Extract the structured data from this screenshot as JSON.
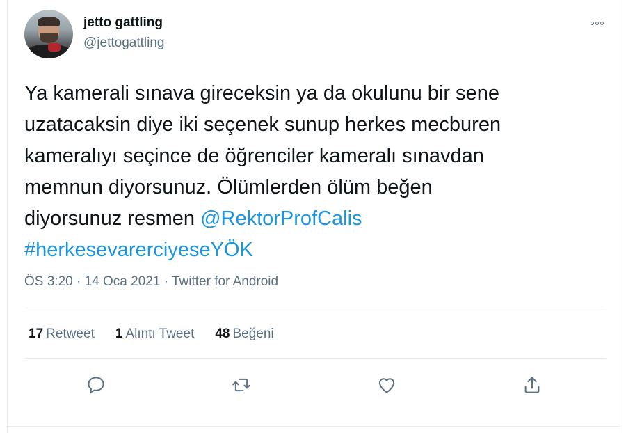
{
  "author": {
    "name": "jetto gattling",
    "handle": "@jettogattling"
  },
  "tweet": {
    "lines": [
      "Ya kamerali sınava gireceksin ya da okulunu bir sene",
      "uzatacaksin diye iki seçenek sunup herkes mecburen",
      "kameralıyı seçince de öğrenciler kameralı sınavdan",
      "memnun diyorsunuz. Ölümlerden ölüm beğen"
    ],
    "line5_text": "diyorsunuz resmen ",
    "mention": "@RektorProfCalis",
    "hashtag": "#herkesevarerciyeseYÖK"
  },
  "meta": {
    "time": "ÖS 3:20",
    "separator1": " · ",
    "date": "14 Oca 2021",
    "separator2": " · ",
    "source": "Twitter for Android"
  },
  "stats": {
    "retweets_count": "17",
    "retweets_label": "Retweet",
    "quotes_count": "1",
    "quotes_label": "Alıntı Tweet",
    "likes_count": "48",
    "likes_label": "Beğeni"
  },
  "icons": {
    "reply": "reply-icon",
    "retweet": "retweet-icon",
    "like": "heart-icon",
    "share": "share-icon",
    "more": "more-icon"
  },
  "colors": {
    "link": "#1b95e0",
    "secondary_text": "#5b7083",
    "icon": "#5b7083",
    "divider": "#e6ecf0"
  }
}
